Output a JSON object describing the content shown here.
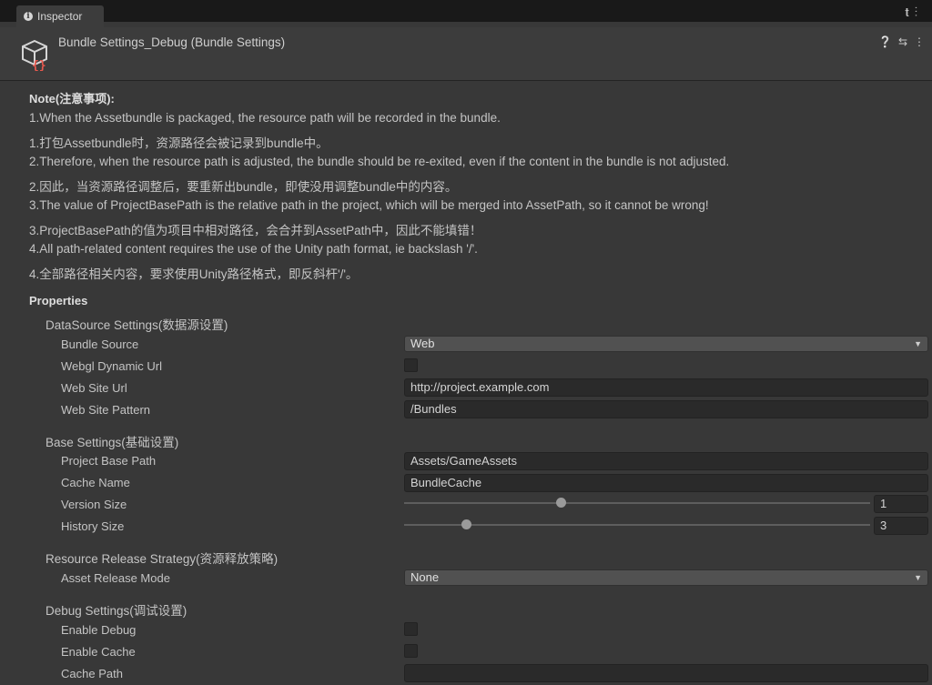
{
  "tab": {
    "title": "Inspector"
  },
  "header": {
    "title": "Bundle Settings_Debug (Bundle Settings)"
  },
  "note": {
    "title": "Note(注意事项):",
    "lines": [
      "1.When the Assetbundle is packaged, the resource path will be recorded in the bundle.",
      "1.打包Assetbundle时，资源路径会被记录到bundle中。",
      "2.Therefore, when the resource path is adjusted, the bundle should be re-exited, even if the content in the bundle is not adjusted.",
      "2.因此，当资源路径调整后，要重新出bundle，即使没用调整bundle中的内容。",
      "3.The value of ProjectBasePath is the relative path in the project, which will be merged into AssetPath, so it cannot be wrong!",
      "3.ProjectBasePath的值为项目中相对路径，会合并到AssetPath中，因此不能填错！",
      "4.All path-related content requires the use of the Unity path format, ie backslash '/'.",
      "4.全部路径相关内容，要求使用Unity路径格式，即反斜杆'/'。"
    ]
  },
  "properties": {
    "title": "Properties",
    "datasource": {
      "title": "DataSource Settings(数据源设置)",
      "bundle_source_label": "Bundle Source",
      "bundle_source_value": "Web",
      "webgl_dynamic_url_label": "Webgl Dynamic Url",
      "web_site_url_label": "Web Site Url",
      "web_site_url_value": "http://project.example.com",
      "web_site_pattern_label": "Web Site Pattern",
      "web_site_pattern_value": "/Bundles"
    },
    "base": {
      "title": "Base Settings(基础设置)",
      "project_base_path_label": "Project Base Path",
      "project_base_path_value": "Assets/GameAssets",
      "cache_name_label": "Cache Name",
      "cache_name_value": "BundleCache",
      "version_size_label": "Version Size",
      "version_size_value": "1",
      "history_size_label": "History Size",
      "history_size_value": "3"
    },
    "release": {
      "title": "Resource Release Strategy(资源释放策略)",
      "asset_release_mode_label": "Asset Release Mode",
      "asset_release_mode_value": "None"
    },
    "debug": {
      "title": "Debug Settings(调试设置)",
      "enable_debug_label": "Enable Debug",
      "enable_cache_label": "Enable Cache",
      "cache_path_label": "Cache Path",
      "cache_path_value": ""
    }
  }
}
